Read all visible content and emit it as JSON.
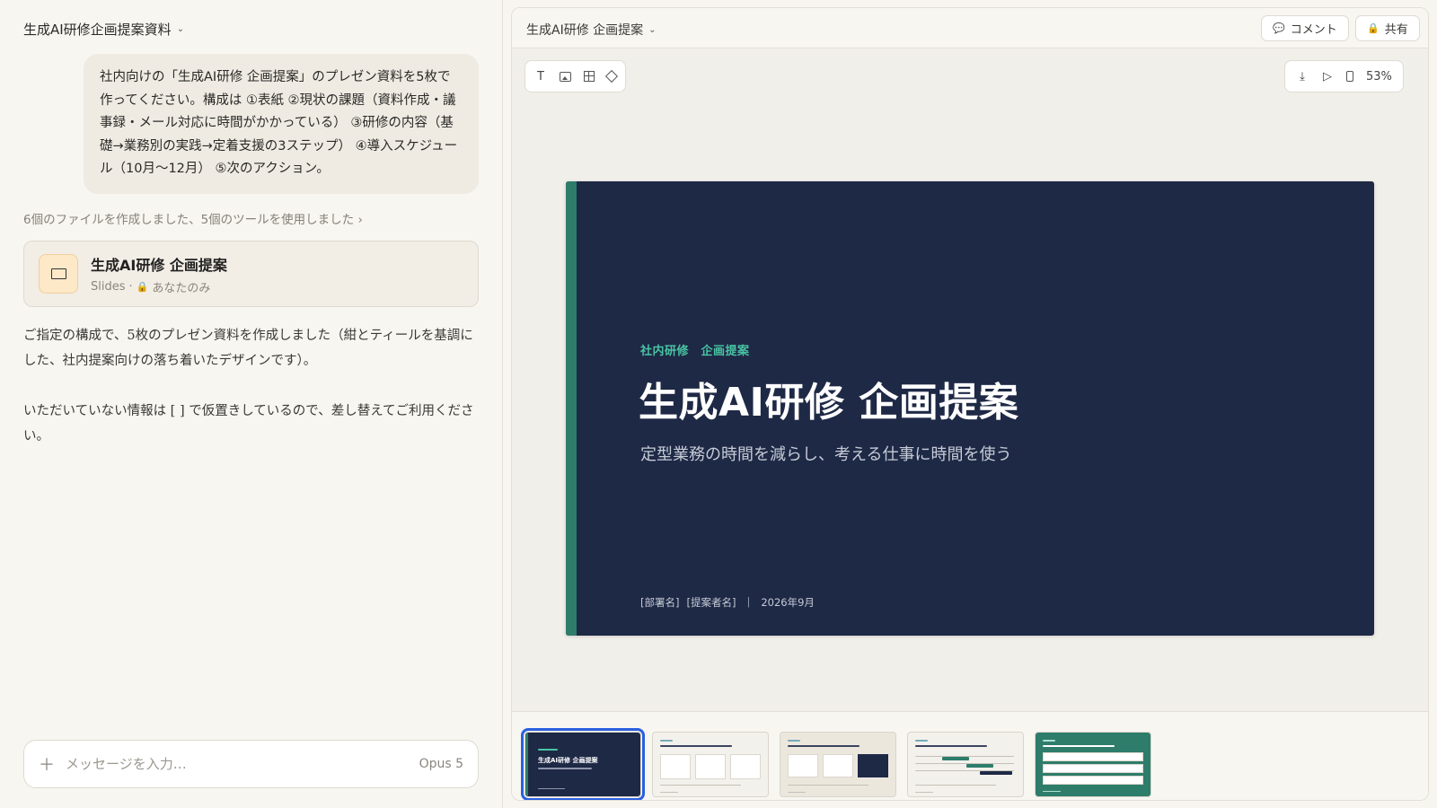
{
  "chat": {
    "title": "生成AI研修企画提案資料",
    "user_message": "社内向けの「生成AI研修 企画提案」のプレゼン資料を5枚で作ってください。構成は ①表紙 ②現状の課題（資料作成・議事録・メール対応に時間がかかっている） ③研修の内容（基礎→業務別の実践→定着支援の3ステップ） ④導入スケジュール（10月〜12月） ⑤次のアクション。",
    "tool_summary": "6個のファイルを作成しました、5個のツールを使用しました ›",
    "artifact": {
      "name": "生成AI研修 企画提案",
      "type": "Slides",
      "visibility": "あなたのみ"
    },
    "assistant_paragraphs": [
      "ご指定の構成で、5枚のプレゼン資料を作成しました（紺とティールを基調にした、社内提案向けの落ち着いたデザインです）。",
      "いただいていない情報は [ ] で仮置きしているので、差し替えてご利用ください。"
    ],
    "input": {
      "placeholder": "メッセージを入力…",
      "value": "",
      "model": "Opus 5"
    }
  },
  "viewer": {
    "title": "生成AI研修 企画提案",
    "comment_label": "コメント",
    "share_label": "共有",
    "zoom": "53%",
    "toolbar_left": [
      "T",
      "image",
      "table",
      "shape"
    ],
    "slide": {
      "tag": "社内研修　企画提案",
      "title": "生成AI研修 企画提案",
      "subtitle": "定型業務の時間を減らし、考える仕事に時間を使う",
      "footer_dept": "[部署名]",
      "footer_author": "[提案者名]",
      "footer_sep": "|",
      "footer_date": "2026年9月"
    },
    "thumbnails": [
      {
        "label": "生成AI研修 企画提案",
        "active": true
      },
      {
        "label": "",
        "active": false
      },
      {
        "label": "",
        "active": false
      },
      {
        "label": "",
        "active": false
      },
      {
        "label": "",
        "active": false
      }
    ]
  },
  "colors": {
    "slide_bg": "#1e2946",
    "accent_teal": "#2e7d6b",
    "tag_teal": "#49c4a3",
    "active_thumb": "#2b5fe0"
  }
}
